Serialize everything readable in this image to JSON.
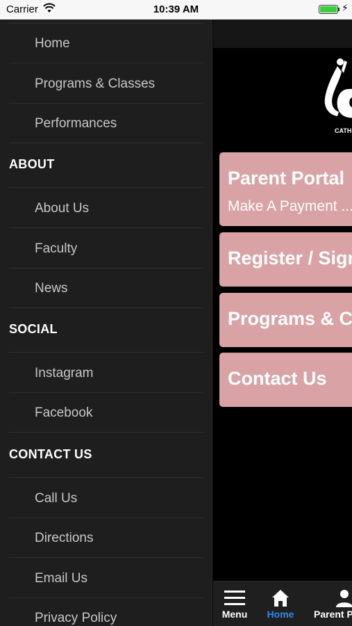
{
  "status_bar": {
    "carrier": "Carrier",
    "time": "10:39 AM"
  },
  "drawer": {
    "items_top": [
      "Home",
      "Programs & Classes",
      "Performances"
    ],
    "sections": [
      {
        "title": "ABOUT",
        "items": [
          "About Us",
          "Faculty",
          "News"
        ]
      },
      {
        "title": "SOCIAL",
        "items": [
          "Instagram",
          "Facebook"
        ]
      },
      {
        "title": "CONTACT US",
        "items": [
          "Call Us",
          "Directions",
          "Email Us",
          "Privacy Policy"
        ]
      }
    ]
  },
  "main": {
    "logo_caption": "CATH",
    "tiles": [
      {
        "title": "Parent Portal",
        "subtitle": "Make A Payment ..."
      },
      {
        "title": "Register / Sign"
      },
      {
        "title": "Programs & Cl"
      },
      {
        "title": "Contact Us"
      }
    ]
  },
  "tab_bar": {
    "tabs": [
      {
        "label": "Menu",
        "icon": "hamburger-menu-icon",
        "active": false
      },
      {
        "label": "Home",
        "icon": "home-icon",
        "active": true
      },
      {
        "label": "Parent P",
        "icon": "person-icon",
        "active": false
      }
    ],
    "active_color": "#2f8be6"
  },
  "colors": {
    "tile": "#d9a3a6",
    "drawer_bg": "#1e1e1e"
  }
}
